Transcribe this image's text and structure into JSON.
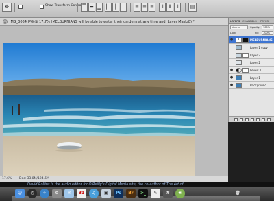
{
  "options_bar": {
    "show_transform_label": "Show Transform Controls"
  },
  "document": {
    "tab_title": "IMG_3064.JPG @ 17.7% (MELBURNIANS will be able to water their gardens at any time and, Layer Mask/8) *",
    "zoom": "17.6%",
    "doc_size": "Doc: 33.8M/124.6M"
  },
  "layers_panel": {
    "tabs": [
      "LAYERS",
      "CHANNELS",
      "PATHS"
    ],
    "blend_mode": "Normal",
    "opacity_label": "Opacity:",
    "opacity_value": "100%",
    "lock_label": "Lock:",
    "fill_label": "Fill:",
    "fill_value": "100%",
    "layers": [
      {
        "name": "MELBURNIANS",
        "selected": true,
        "type": "text",
        "has_mask": true
      },
      {
        "name": "Layer 1 copy",
        "selected": false,
        "type": "pixel",
        "has_mask": false
      },
      {
        "name": "Layer 2",
        "selected": false,
        "type": "pixel",
        "has_mask": true
      },
      {
        "name": "Layer 2",
        "selected": false,
        "type": "pixel",
        "has_mask": false
      },
      {
        "name": "Levels 1",
        "selected": false,
        "type": "adjustment",
        "has_mask": true
      },
      {
        "name": "Layer 1",
        "selected": false,
        "type": "pixel",
        "has_mask": false
      },
      {
        "name": "Background",
        "selected": false,
        "type": "pixel",
        "has_mask": false
      }
    ]
  },
  "caption": "David Rollins is the audio editor for O'Reilly's Digital Media site, the co-author of The Art of",
  "dock": {
    "apps": [
      "Finder",
      "Dashboard",
      "Safari",
      "System Preferences",
      "Mail",
      "iCal",
      "iTunes",
      "Preview",
      "Photoshop",
      "Bridge",
      "Terminal",
      "TextEdit",
      "Calculator",
      "iPhoto",
      "Trash"
    ]
  },
  "colors": {
    "selection": "#3d74d1",
    "sky": "#2e86d6",
    "sea": "#1f6f9c",
    "sand": "#d9cdb5"
  }
}
